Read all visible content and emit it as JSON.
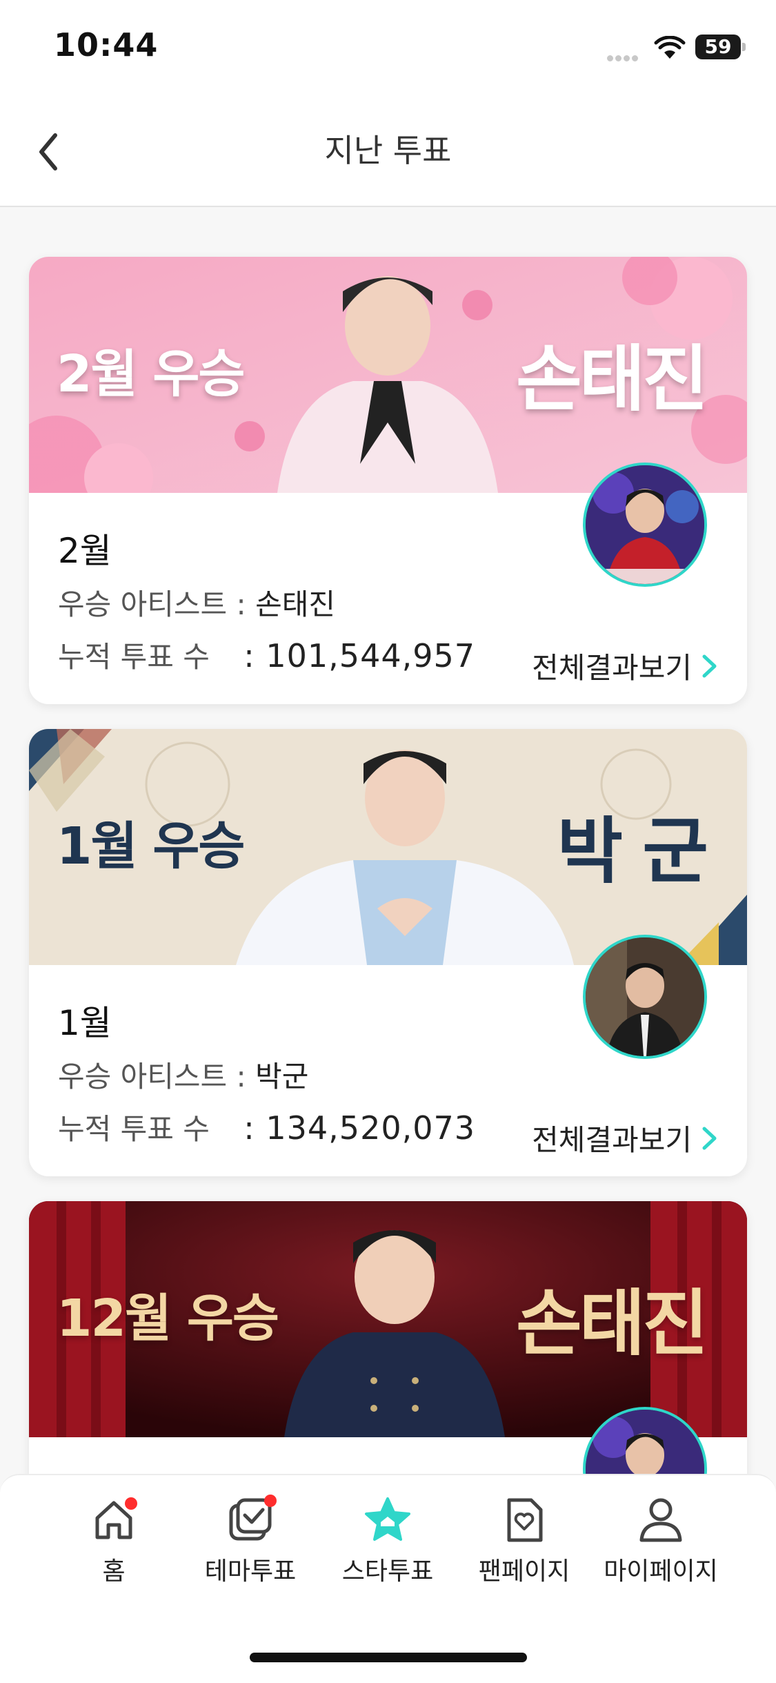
{
  "status_bar": {
    "time": "10:44",
    "battery": "59"
  },
  "header": {
    "title": "지난 투표"
  },
  "cards": [
    {
      "banner_left": "2월 우승",
      "banner_right": "손태진",
      "month": "2월",
      "winner_label": "우승 아티스트 :",
      "winner_name": "손태진",
      "votes_label": "누적 투표 수",
      "votes_value": ": 101,544,957",
      "more_label": "전체결과보기"
    },
    {
      "banner_left": "1월 우승",
      "banner_right": "박 군",
      "month": "1월",
      "winner_label": "우승 아티스트 :",
      "winner_name": "박군",
      "votes_label": "누적 투표 수",
      "votes_value": ": 134,520,073",
      "more_label": "전체결과보기"
    },
    {
      "banner_left": "12월 우승",
      "banner_right": "손태진"
    }
  ],
  "bottom_nav": {
    "items": [
      {
        "label": "홈",
        "icon": "home-icon",
        "badge": true
      },
      {
        "label": "테마투표",
        "icon": "theme-vote-icon",
        "badge": true
      },
      {
        "label": "스타투표",
        "icon": "star-vote-icon",
        "active": true
      },
      {
        "label": "팬페이지",
        "icon": "fanpage-icon"
      },
      {
        "label": "마이페이지",
        "icon": "mypage-icon"
      }
    ]
  },
  "colors": {
    "accent": "#2fd6c9",
    "badge": "#ff2d2d"
  }
}
